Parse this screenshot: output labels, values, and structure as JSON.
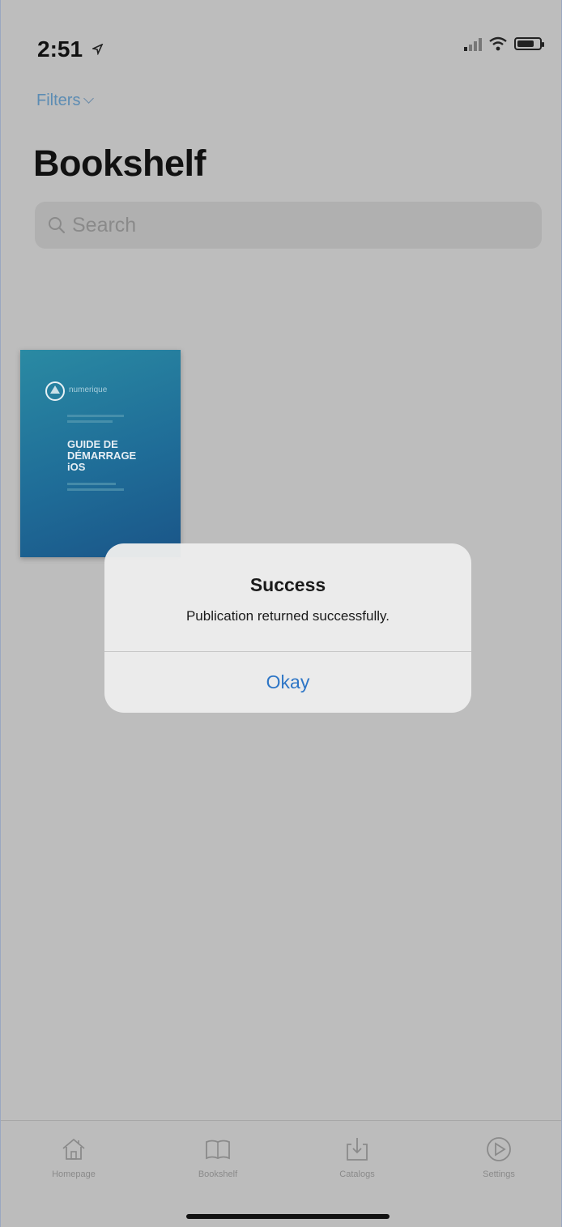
{
  "status_bar": {
    "time": "2:51"
  },
  "header": {
    "filters_label": "Filters",
    "title": "Bookshelf"
  },
  "search": {
    "placeholder": "Search"
  },
  "book": {
    "brand": "numerique",
    "cover_title": "GUIDE DE\nDÉMARRAGE\niOS"
  },
  "alert": {
    "title": "Success",
    "message": "Publication returned successfully.",
    "button": "Okay"
  },
  "tabs": [
    {
      "label": "Homepage",
      "icon": "house-icon"
    },
    {
      "label": "Bookshelf",
      "icon": "book-icon"
    },
    {
      "label": "Catalogs",
      "icon": "download-tray-icon"
    },
    {
      "label": "Settings",
      "icon": "play-circle-icon"
    }
  ]
}
